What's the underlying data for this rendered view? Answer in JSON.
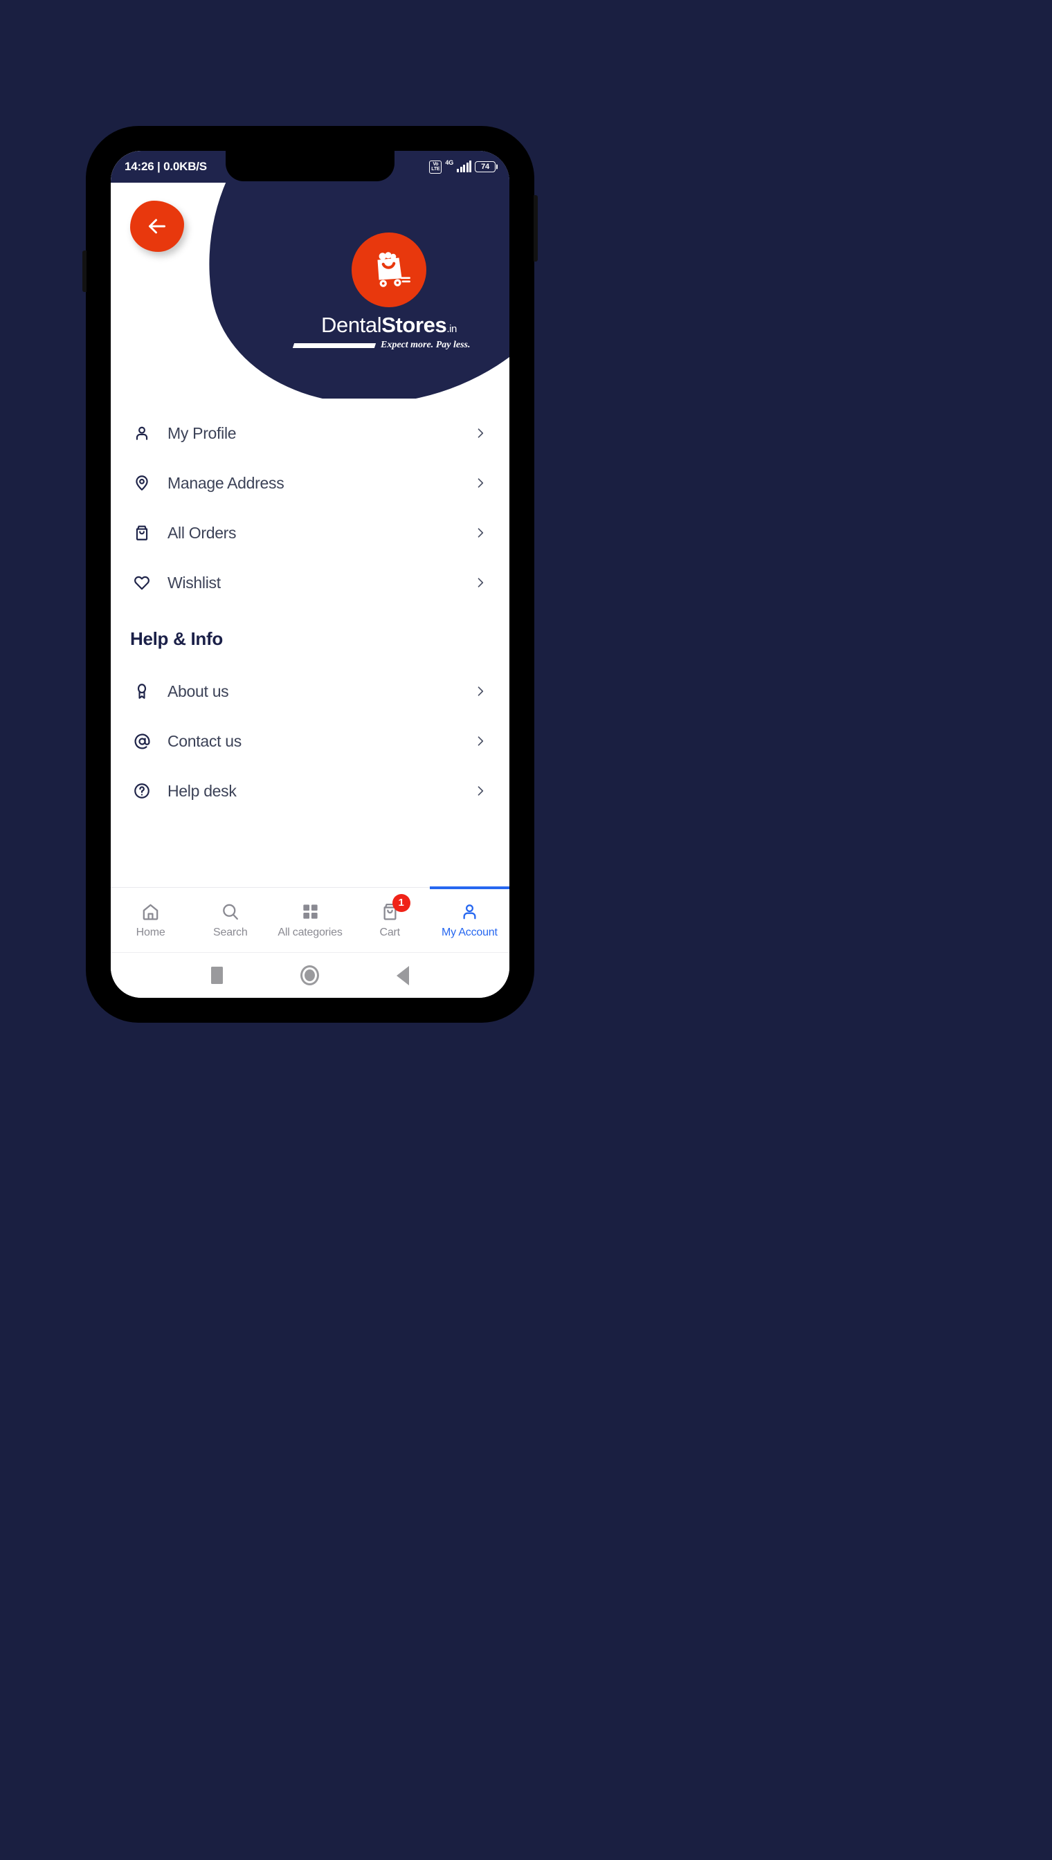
{
  "status_bar": {
    "time_and_speed": "14:26 | 0.0KB/S",
    "volte_line1": "Vo",
    "volte_line2": "LTE",
    "network": "4G",
    "battery": "74"
  },
  "header": {
    "back_icon": "arrow-left-icon",
    "brand_part1": "Dental",
    "brand_part2": "Stores",
    "brand_tld": ".in",
    "tagline": "Expect more. Pay less.",
    "logo_icon": "shopping-bag-cart-icon",
    "brand_bg_color": "#1f244c",
    "accent_color": "#e8380d"
  },
  "account_menu": [
    {
      "label": "My Profile",
      "icon": "user-icon"
    },
    {
      "label": "Manage Address",
      "icon": "map-pin-icon"
    },
    {
      "label": "All Orders",
      "icon": "shopping-bag-icon"
    },
    {
      "label": "Wishlist",
      "icon": "heart-icon"
    }
  ],
  "help_section": {
    "title": "Help & Info",
    "items": [
      {
        "label": "About us",
        "icon": "award-icon"
      },
      {
        "label": "Contact us",
        "icon": "at-sign-icon"
      },
      {
        "label": "Help desk",
        "icon": "help-circle-icon"
      }
    ]
  },
  "bottom_nav": {
    "active_color": "#2667f0",
    "inactive_color": "#8a8a92",
    "items": [
      {
        "label": "Home",
        "icon": "home-icon",
        "active": false,
        "badge": ""
      },
      {
        "label": "Search",
        "icon": "search-icon",
        "active": false,
        "badge": ""
      },
      {
        "label": "All categories",
        "icon": "grid-icon",
        "active": false,
        "badge": ""
      },
      {
        "label": "Cart",
        "icon": "cart-bag-icon",
        "active": false,
        "badge": "1"
      },
      {
        "label": "My Account",
        "icon": "user-icon",
        "active": true,
        "badge": ""
      }
    ]
  },
  "android_nav": {
    "recents": "square-icon",
    "home": "circle-icon",
    "back": "triangle-back-icon"
  }
}
